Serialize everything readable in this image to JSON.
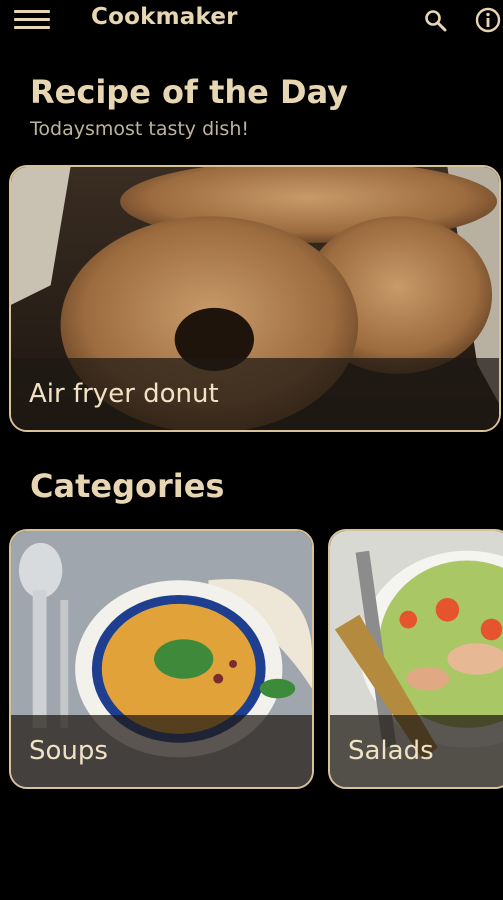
{
  "app": {
    "title": "Cookmaker"
  },
  "icons": {
    "menu": "menu-icon",
    "search": "search-icon",
    "info": "info-icon"
  },
  "colors": {
    "accent": "#e8d6b3",
    "border": "#d9c29a",
    "background": "#000000"
  },
  "recipe_of_day": {
    "heading": "Recipe of the Day",
    "subtitle": "Todaysmost tasty dish!",
    "card_label": "Air fryer donut"
  },
  "categories": {
    "heading": "Categories",
    "items": [
      {
        "label": "Soups"
      },
      {
        "label": "Salads"
      }
    ]
  }
}
